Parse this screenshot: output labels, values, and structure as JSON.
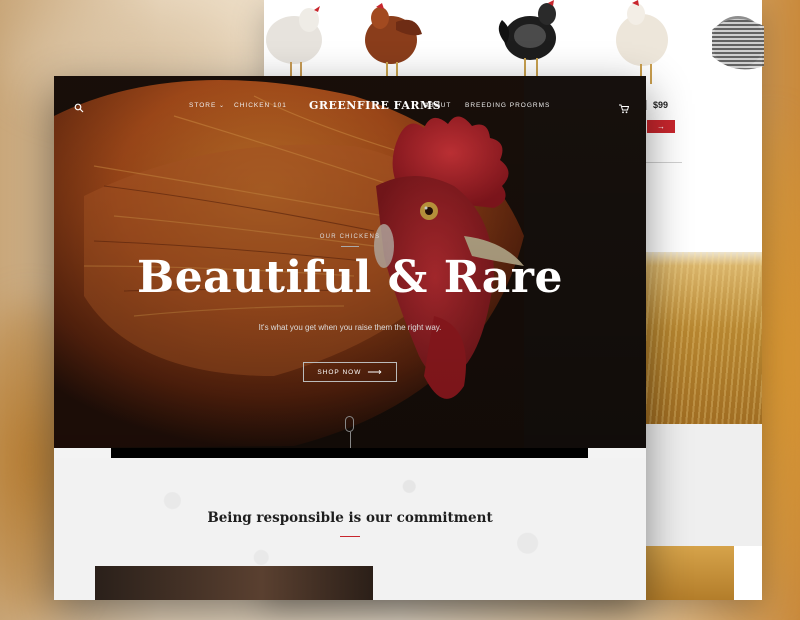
{
  "front": {
    "nav": {
      "store": "STORE",
      "chicken101": "CHICKEN 101",
      "brand": "GREENFIRE FARMS",
      "about": "ABOUT",
      "breeding": "BREEDING PROGRMS"
    },
    "hero": {
      "eyebrow": "OUR CHICKENS",
      "headline": "Beautiful & Rare",
      "subline": "It's what you get when you  raise them the right way.",
      "cta": "SHOP NOW"
    },
    "section": {
      "title": "Being responsible is our commitment"
    }
  },
  "back": {
    "price": "$99"
  },
  "colors": {
    "accent_red": "#c8262d",
    "hero_dark": "#1f120c",
    "rooster_red": "#c2242e",
    "rooster_feather": "#b9541d"
  },
  "icons": {
    "search": "search-icon",
    "cart": "cart-icon",
    "chevron": "chevron-down-icon",
    "arrow": "arrow-right-icon",
    "scroll": "scroll-mouse-icon"
  }
}
